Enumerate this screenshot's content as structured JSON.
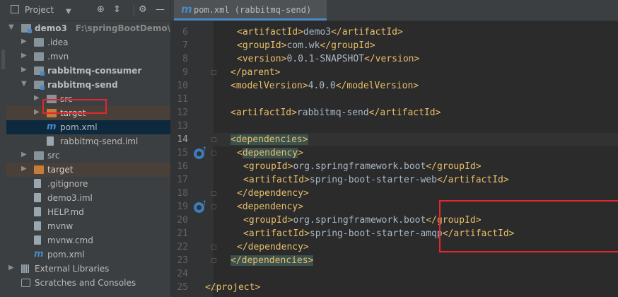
{
  "project_panel": {
    "title": "Project",
    "tree": [
      {
        "label": "demo3",
        "path": "F:\\springBootDemo\\dem",
        "indent": 0,
        "arrow": "▼",
        "icon": "module-folder",
        "bold": true
      },
      {
        "label": ".idea",
        "indent": 1,
        "arrow": "▶",
        "icon": "folder"
      },
      {
        "label": ".mvn",
        "indent": 1,
        "arrow": "▶",
        "icon": "folder"
      },
      {
        "label": "rabbitmq-consumer",
        "indent": 1,
        "arrow": "▶",
        "icon": "module-folder",
        "bold": true
      },
      {
        "label": "rabbitmq-send",
        "indent": 1,
        "arrow": "▼",
        "icon": "module-folder",
        "bold": true
      },
      {
        "label": "src",
        "indent": 2,
        "arrow": "▶",
        "icon": "folder"
      },
      {
        "label": "target",
        "indent": 2,
        "arrow": "▶",
        "icon": "excluded-folder",
        "excluded": true
      },
      {
        "label": "pom.xml",
        "indent": 2,
        "arrow": "",
        "icon": "maven",
        "selected": true
      },
      {
        "label": "rabbitmq-send.iml",
        "indent": 2,
        "arrow": "",
        "icon": "file"
      },
      {
        "label": "src",
        "indent": 1,
        "arrow": "▶",
        "icon": "folder"
      },
      {
        "label": "target",
        "indent": 1,
        "arrow": "▶",
        "icon": "excluded-folder",
        "excluded": true
      },
      {
        "label": ".gitignore",
        "indent": 1,
        "arrow": "",
        "icon": "file"
      },
      {
        "label": "demo3.iml",
        "indent": 1,
        "arrow": "",
        "icon": "file"
      },
      {
        "label": "HELP.md",
        "indent": 1,
        "arrow": "",
        "icon": "markdown-file"
      },
      {
        "label": "mvnw",
        "indent": 1,
        "arrow": "",
        "icon": "file"
      },
      {
        "label": "mvnw.cmd",
        "indent": 1,
        "arrow": "",
        "icon": "file"
      },
      {
        "label": "pom.xml",
        "indent": 1,
        "arrow": "",
        "icon": "maven"
      },
      {
        "label": "External Libraries",
        "indent": 0,
        "arrow": "▶",
        "icon": "libraries"
      },
      {
        "label": "Scratches and Consoles",
        "indent": 0,
        "arrow": "",
        "icon": "scratches"
      }
    ]
  },
  "editor": {
    "tab_label": "pom.xml (rabbitmq-send)",
    "current_line": "14",
    "lines": [
      {
        "n": "6",
        "indent": 5,
        "parts": [
          [
            "tag",
            "<artifactId>"
          ],
          [
            "text",
            "demo3"
          ],
          [
            "tag",
            "</artifactId>"
          ]
        ]
      },
      {
        "n": "7",
        "indent": 5,
        "parts": [
          [
            "tag",
            "<groupId>"
          ],
          [
            "text",
            "com.wk"
          ],
          [
            "tag",
            "</groupId>"
          ]
        ]
      },
      {
        "n": "8",
        "indent": 5,
        "parts": [
          [
            "tag",
            "<version>"
          ],
          [
            "text",
            "0.0.1-SNAPSHOT"
          ],
          [
            "tag",
            "</version>"
          ]
        ]
      },
      {
        "n": "9",
        "indent": 4,
        "parts": [
          [
            "tag",
            "</parent>"
          ]
        ]
      },
      {
        "n": "10",
        "indent": 4,
        "parts": [
          [
            "tag",
            "<modelVersion>"
          ],
          [
            "text",
            "4.0.0"
          ],
          [
            "tag",
            "</modelVersion>"
          ]
        ]
      },
      {
        "n": "11",
        "indent": 0,
        "parts": []
      },
      {
        "n": "12",
        "indent": 4,
        "parts": [
          [
            "tag",
            "<artifactId>"
          ],
          [
            "text",
            "rabbitmq-send"
          ],
          [
            "tag",
            "</artifactId>"
          ]
        ]
      },
      {
        "n": "13",
        "indent": 0,
        "parts": []
      },
      {
        "n": "14",
        "indent": 4,
        "parts": [
          [
            "tagh",
            "<dependencies>"
          ]
        ]
      },
      {
        "n": "15",
        "indent": 5,
        "parts": [
          [
            "tag",
            "<"
          ],
          [
            "tagh",
            "dependency"
          ],
          [
            "tag",
            ">"
          ]
        ]
      },
      {
        "n": "16",
        "indent": 6,
        "parts": [
          [
            "tag",
            "<groupId>"
          ],
          [
            "text",
            "org.springframework.boot"
          ],
          [
            "tag",
            "</groupId>"
          ]
        ]
      },
      {
        "n": "17",
        "indent": 6,
        "parts": [
          [
            "tag",
            "<artifactId>"
          ],
          [
            "text",
            "spring-boot-starter-web"
          ],
          [
            "tag",
            "</artifactId>"
          ]
        ]
      },
      {
        "n": "18",
        "indent": 5,
        "parts": [
          [
            "tag",
            "</dependency>"
          ]
        ]
      },
      {
        "n": "19",
        "indent": 5,
        "parts": [
          [
            "tag",
            "<dependency>"
          ]
        ]
      },
      {
        "n": "20",
        "indent": 6,
        "parts": [
          [
            "tag",
            "<groupId>"
          ],
          [
            "text",
            "org.springframework.boot"
          ],
          [
            "tag",
            "</groupId>"
          ]
        ]
      },
      {
        "n": "21",
        "indent": 6,
        "parts": [
          [
            "tag",
            "<artifactId>"
          ],
          [
            "text",
            "spring-boot-starter-amqp"
          ],
          [
            "tag",
            "</artifactId>"
          ]
        ]
      },
      {
        "n": "22",
        "indent": 5,
        "parts": [
          [
            "tag",
            "</dependency>"
          ]
        ]
      },
      {
        "n": "23",
        "indent": 4,
        "parts": [
          [
            "tagh",
            "</dependencies>"
          ]
        ]
      },
      {
        "n": "24",
        "indent": 0,
        "parts": []
      },
      {
        "n": "25",
        "indent": 0,
        "parts": [
          [
            "tag",
            "</project>"
          ]
        ]
      }
    ]
  },
  "colors": {
    "tag": "#e8bf6a",
    "text": "#a9b7c6",
    "highlight_red": "#e0282e",
    "maven_blue": "#4a88c7"
  }
}
